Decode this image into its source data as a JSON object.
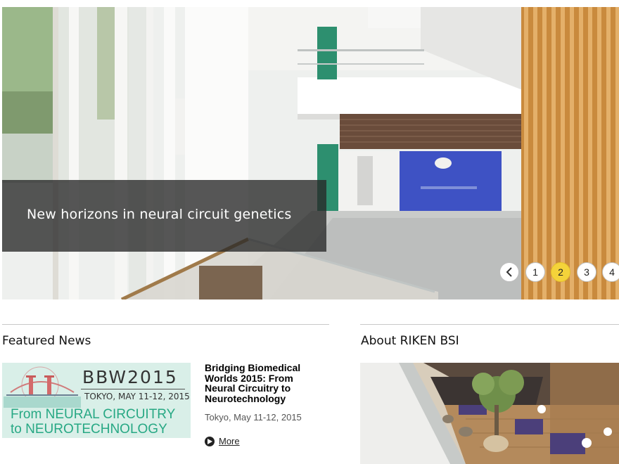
{
  "hero": {
    "caption": "New horizons in neural circuit genetics",
    "slider": {
      "prev_icon": "chevron-left-icon",
      "pages": [
        "1",
        "2",
        "3",
        "4"
      ],
      "active_page": "2",
      "active_color": "#f4d33a"
    }
  },
  "featured_news": {
    "heading": "Featured News",
    "item": {
      "thumbnail": {
        "title": "BBW2015",
        "date": "TOKYO, MAY 11-12, 2015",
        "line1": "From NEURAL CIRCUITRY",
        "line2": "to NEUROTECHNOLOGY"
      },
      "headline": "Bridging Biomedical Worlds 2015: From Neural Circuitry to Neurotechnology",
      "date": "Tokyo, May 11-12, 2015",
      "more_label": "More",
      "more_icon": "play-circle-icon"
    }
  },
  "about": {
    "heading": "About RIKEN BSI"
  }
}
